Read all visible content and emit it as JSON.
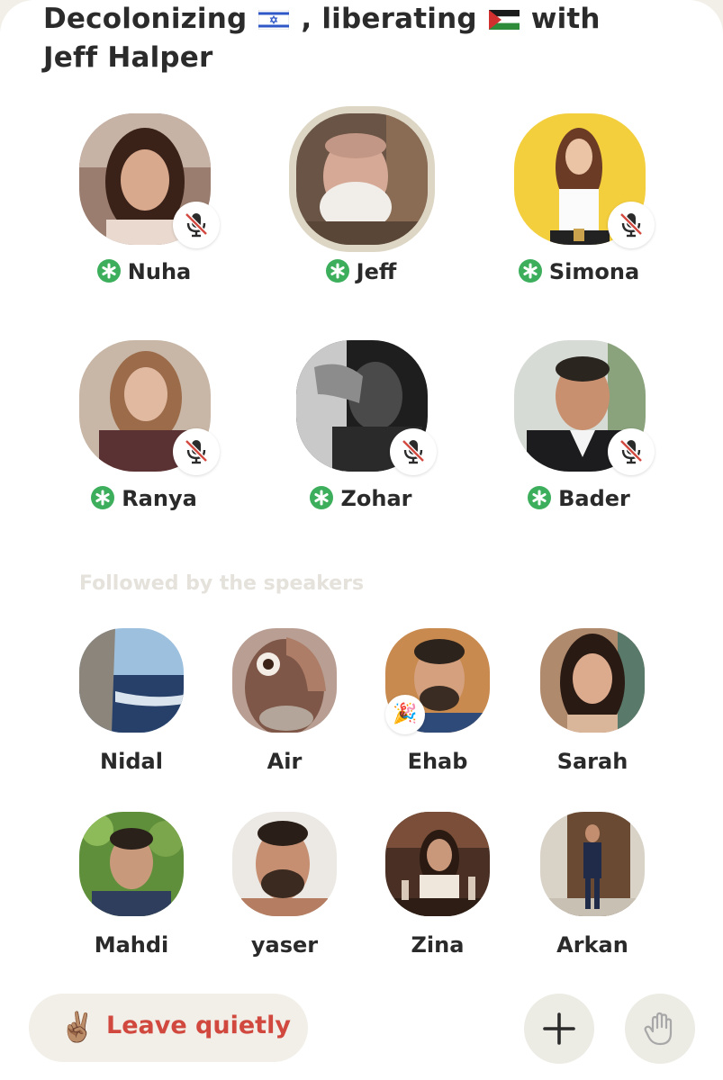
{
  "room": {
    "title_part1": "Decolonizing",
    "title_part2": ", liberating",
    "title_part3": "with",
    "title_line2": "Jeff Halper"
  },
  "speakers": [
    {
      "name": "Nuha",
      "moderator": true,
      "muted": true
    },
    {
      "name": "Jeff",
      "moderator": true,
      "muted": false,
      "speaking": true
    },
    {
      "name": "Simona",
      "moderator": true,
      "muted": true
    },
    {
      "name": "Ranya",
      "moderator": true,
      "muted": true
    },
    {
      "name": "Zohar",
      "moderator": true,
      "muted": true
    },
    {
      "name": "Bader",
      "moderator": true,
      "muted": true
    }
  ],
  "section": {
    "followed_label": "Followed by the speakers"
  },
  "listeners": [
    {
      "name": "Nidal"
    },
    {
      "name": "Air"
    },
    {
      "name": "Ehab",
      "badge": "🎉"
    },
    {
      "name": "Sarah"
    },
    {
      "name": "Mahdi"
    },
    {
      "name": "yaser"
    },
    {
      "name": "Zina"
    },
    {
      "name": "Arkan"
    }
  ],
  "bottom_bar": {
    "leave_icon": "✌🏽",
    "leave_label": "Leave quietly"
  },
  "icons": {
    "mute": "mic-off-icon",
    "moderator": "asterisk-icon",
    "add": "plus-icon",
    "raise_hand": "hand-icon"
  },
  "colors": {
    "background": "#f1efe7",
    "leave_text": "#d1483f",
    "moderator_badge": "#3cae5c",
    "section_label": "#e5e2dc",
    "text": "#2a2a2a"
  }
}
